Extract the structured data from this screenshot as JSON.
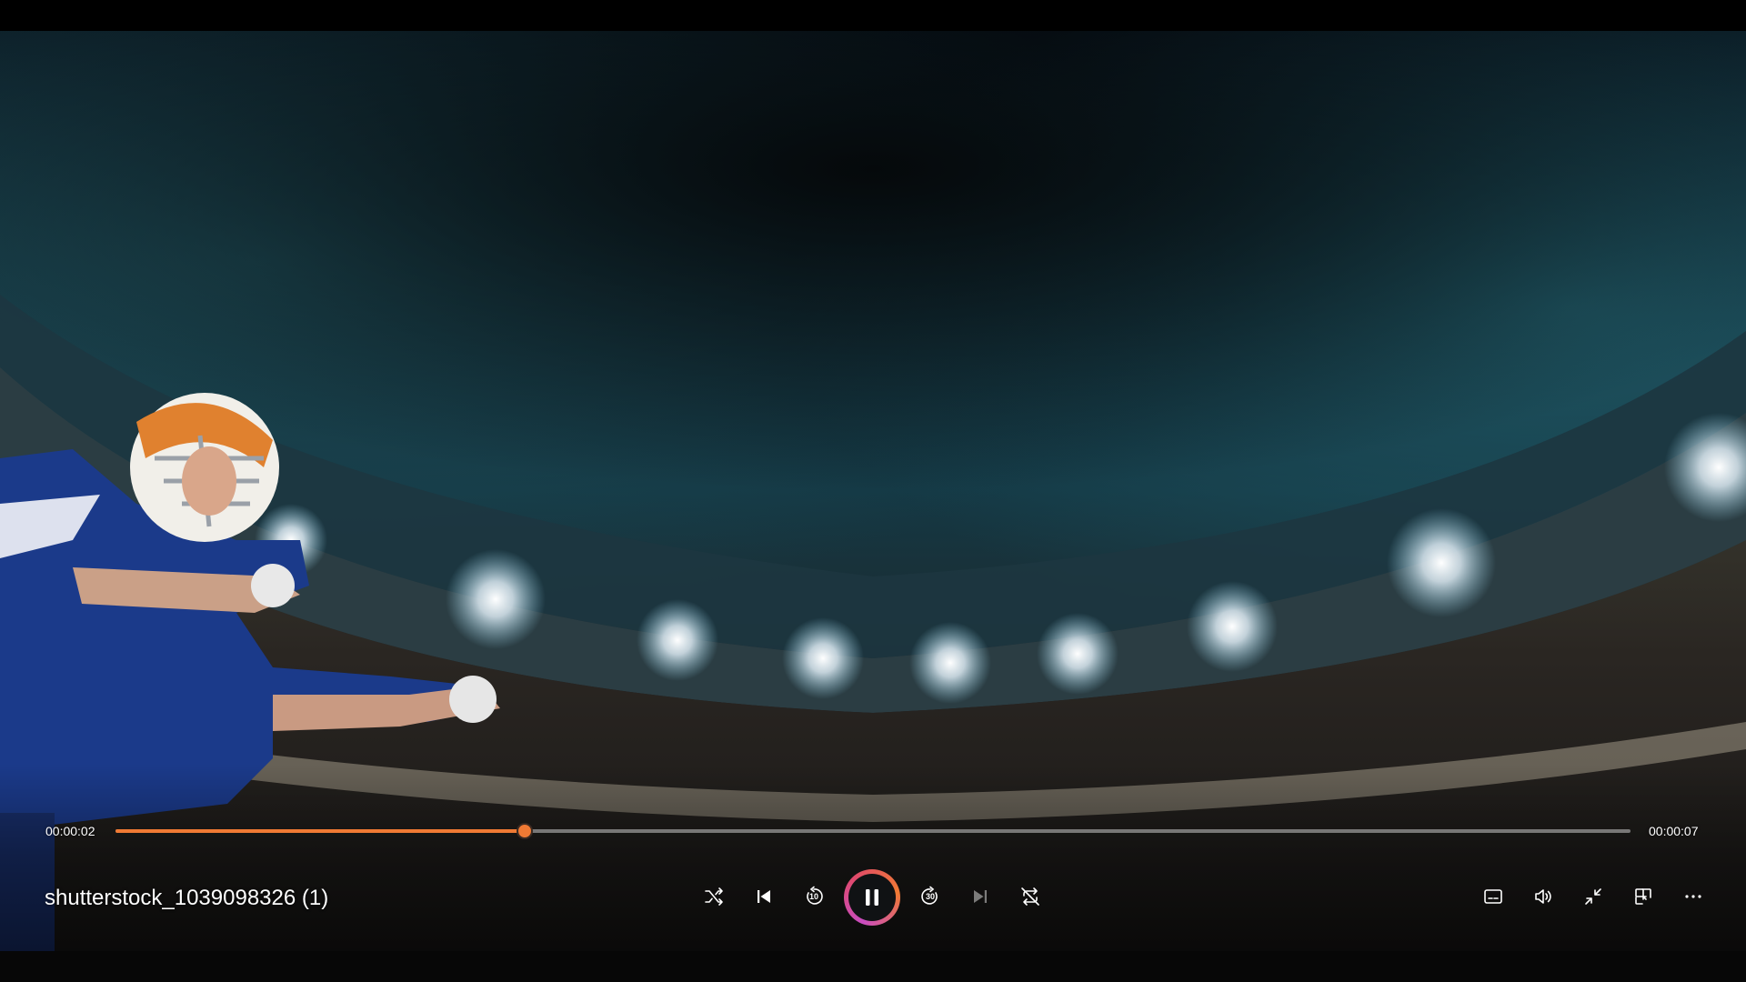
{
  "player": {
    "title": "shutterstock_1039098326 (1)",
    "time_current": "00:00:02",
    "time_total": "00:00:07",
    "progress": 0.27,
    "accent_color": "#f07a34"
  },
  "controls": {
    "left": [
      {
        "name": "shuffle-icon",
        "enabled": true
      },
      {
        "name": "previous-icon",
        "enabled": true
      },
      {
        "name": "skip-back-10-icon",
        "label": "10",
        "enabled": true
      },
      {
        "name": "pause-icon",
        "enabled": true
      },
      {
        "name": "skip-forward-30-icon",
        "label": "30",
        "enabled": true
      },
      {
        "name": "next-icon",
        "enabled": false
      },
      {
        "name": "repeat-off-icon",
        "enabled": true
      }
    ],
    "right": [
      {
        "name": "subtitles-icon"
      },
      {
        "name": "volume-icon"
      },
      {
        "name": "exit-fullscreen-icon"
      },
      {
        "name": "mini-view-icon"
      },
      {
        "name": "more-options-icon"
      }
    ]
  }
}
